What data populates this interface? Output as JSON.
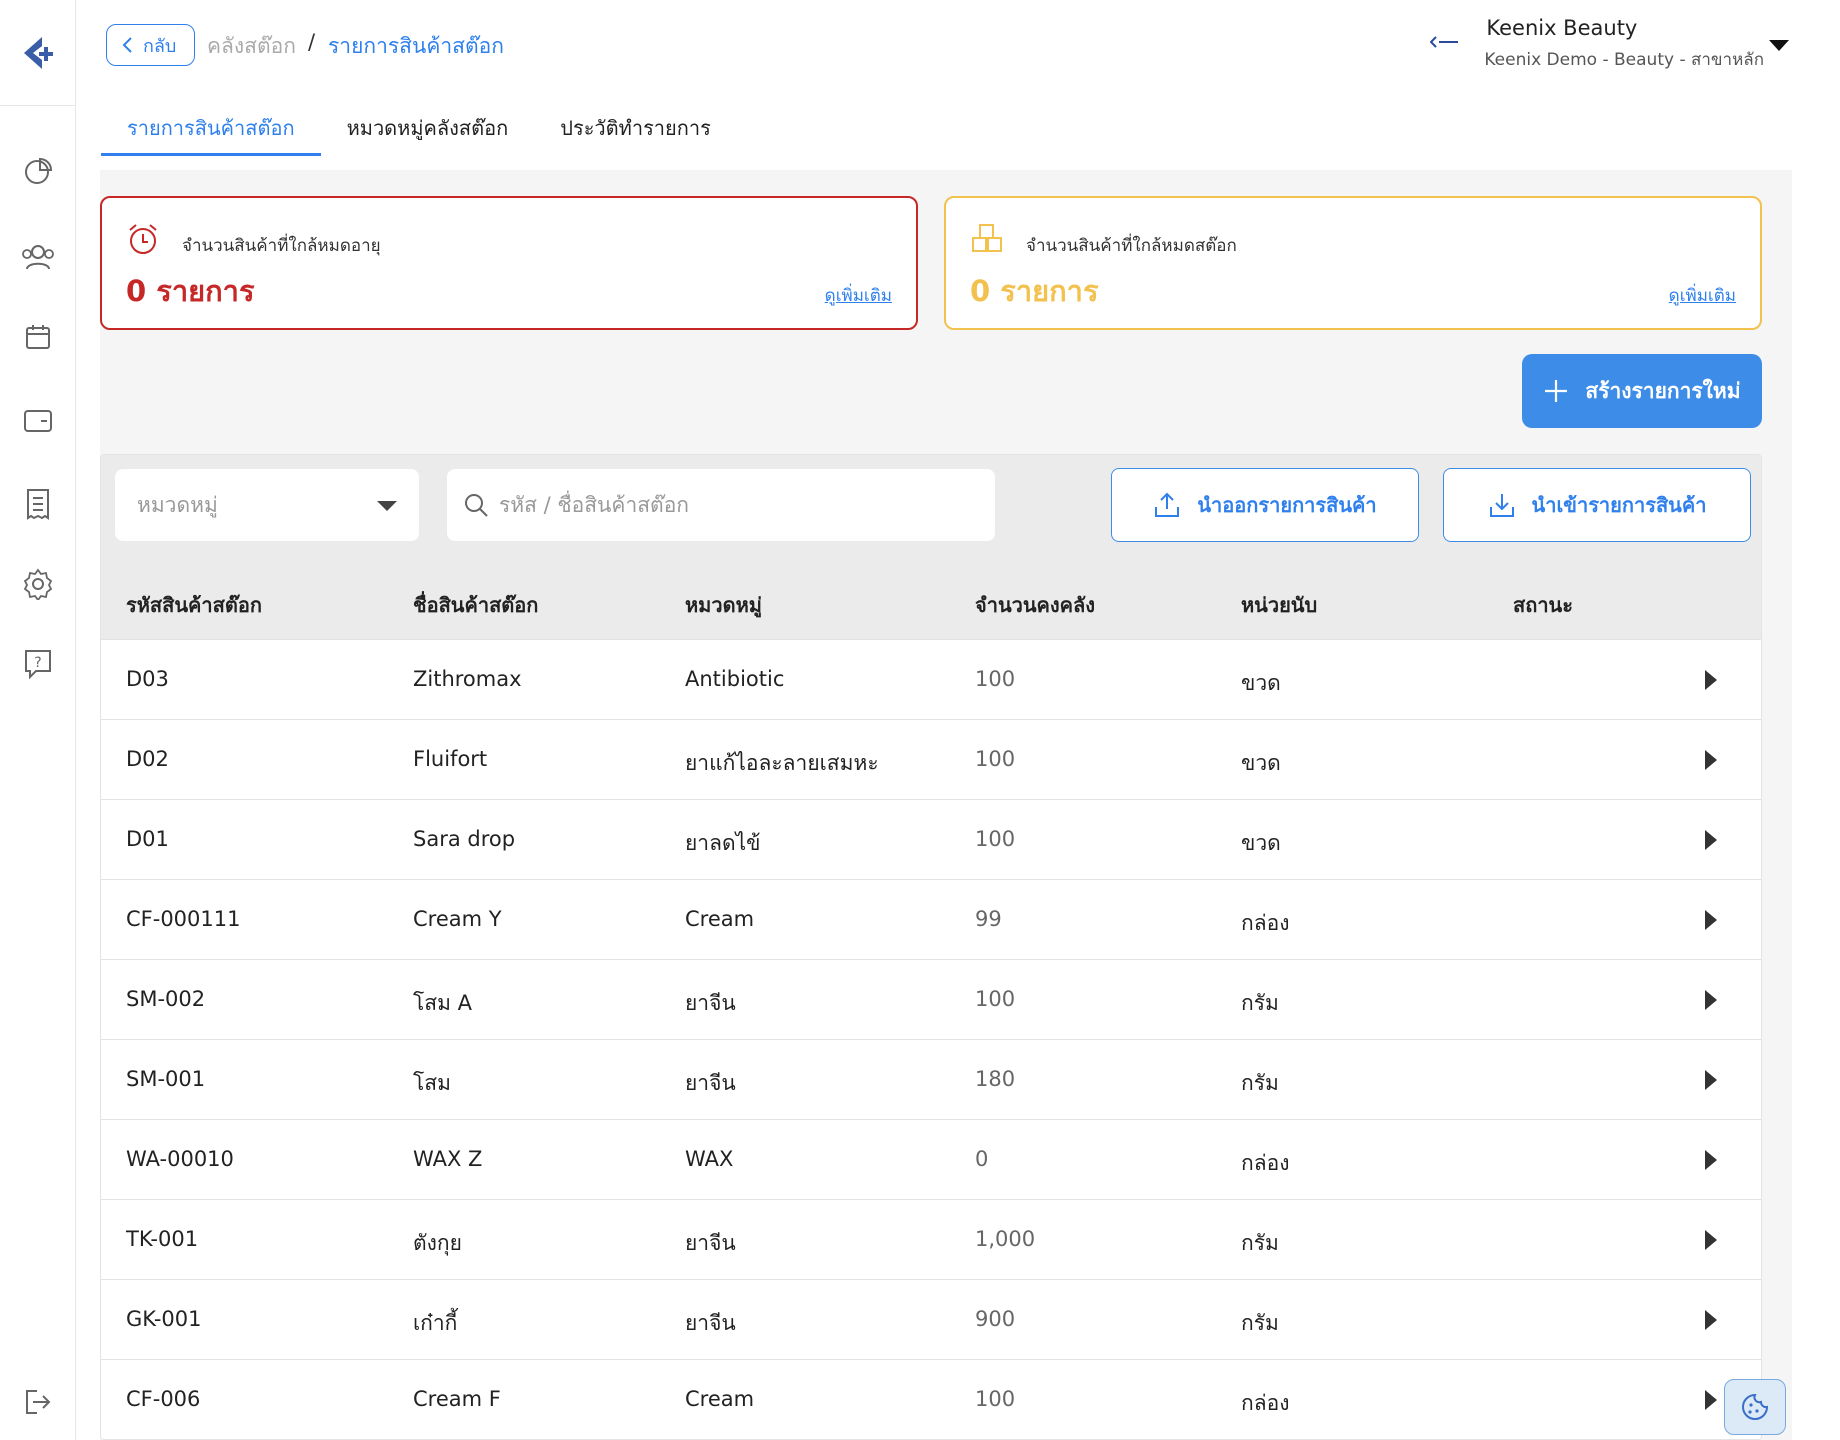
{
  "breadcrumb": {
    "back_label": "กลับ",
    "parent": "คลังสต๊อก",
    "separator": "/",
    "current": "รายการสินค้าสต๊อก"
  },
  "org": {
    "name": "Keenix Beauty",
    "subtitle": "Keenix Demo - Beauty - สาขาหลัก"
  },
  "tabs": [
    {
      "label": "รายการสินค้าสต๊อก",
      "active": true
    },
    {
      "label": "หมวดหมู่คลังสต๊อก",
      "active": false
    },
    {
      "label": "ประวัติทำรายการ",
      "active": false
    }
  ],
  "cards": {
    "expiring": {
      "label": "จำนวนสินค้าที่ใกล้หมดอายุ",
      "count": "0 รายการ",
      "more": "ดูเพิ่มเติม",
      "color": "#c62828",
      "icon": "alarm-clock-icon"
    },
    "low_stock": {
      "label": "จำนวนสินค้าที่ใกล้หมดสต๊อก",
      "count": "0 รายการ",
      "more": "ดูเพิ่มเติม",
      "color": "#f2c14e",
      "icon": "boxes-icon"
    }
  },
  "create_button": "สร้างรายการใหม่",
  "filters": {
    "category_placeholder": "หมวดหมู่",
    "search_placeholder": "รหัส / ชื่อสินค้าสต๊อก",
    "export_label": "นำออกรายการสินค้า",
    "import_label": "นำเข้ารายการสินค้า"
  },
  "table": {
    "headers": [
      "รหัสสินค้าสต๊อก",
      "ชื่อสินค้าสต๊อก",
      "หมวดหมู่",
      "จำนวนคงคลัง",
      "หน่วยนับ",
      "สถานะ"
    ],
    "rows": [
      [
        "D03",
        "Zithromax",
        "Antibiotic",
        "100",
        "ขวด"
      ],
      [
        "D02",
        "Fluifort",
        "ยาแก้ไอละลายเสมหะ",
        "100",
        "ขวด"
      ],
      [
        "D01",
        "Sara drop",
        "ยาลดไข้",
        "100",
        "ขวด"
      ],
      [
        "CF-000111",
        "Cream Y",
        "Cream",
        "99",
        "กล่อง"
      ],
      [
        "SM-002",
        "โสม A",
        "ยาจีน",
        "100",
        "กรัม"
      ],
      [
        "SM-001",
        "โสม",
        "ยาจีน",
        "180",
        "กรัม"
      ],
      [
        "WA-00010",
        "WAX Z",
        "WAX",
        "0",
        "กล่อง"
      ],
      [
        "TK-001",
        "ตังกุย",
        "ยาจีน",
        "1,000",
        "กรัม"
      ],
      [
        "GK-001",
        "เก๋ากี้",
        "ยาจีน",
        "900",
        "กรัม"
      ],
      [
        "CF-006",
        "Cream F",
        "Cream",
        "100",
        "กล่อง"
      ]
    ]
  },
  "colors": {
    "accent": "#2f80ed",
    "danger": "#c62828",
    "warning": "#f2c14e"
  }
}
